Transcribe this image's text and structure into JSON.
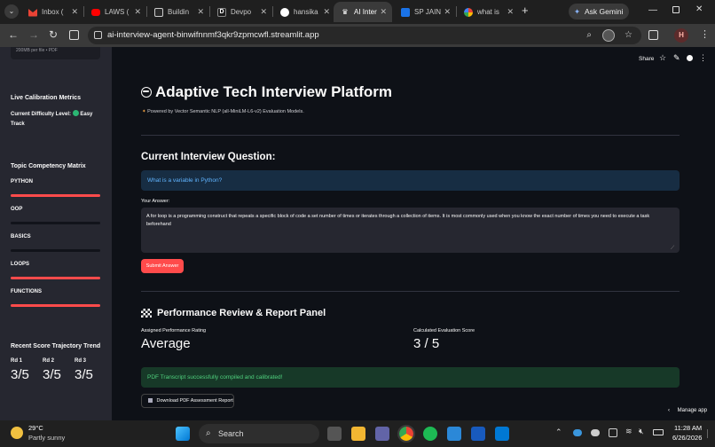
{
  "browser": {
    "tabs": [
      {
        "label": "Inbox (",
        "color": "#ea4335"
      },
      {
        "label": "LAWS (",
        "color": "#ff0000"
      },
      {
        "label": "Buildin",
        "color": "#5f6368"
      },
      {
        "label": "Devpo",
        "color": "#1a73e8"
      },
      {
        "label": "hansika",
        "color": "#ffffff"
      },
      {
        "label": "AI Inter",
        "color": "#ffffff"
      },
      {
        "label": "SP JAIN",
        "color": "#1a73e8"
      },
      {
        "label": "what is",
        "color": "#4285f4"
      }
    ],
    "ask_gemini": "Ask Gemini",
    "url": "ai-interview-agent-binwifnnmf3qkr9zpmcwfl.streamlit.app",
    "profile_initial": "H"
  },
  "toolbar": {
    "share": "Share"
  },
  "sidebar": {
    "upload_hint": "200MB per file • PDF",
    "metrics_title": "Live Calibration Metrics",
    "difficulty_label": "Current Difficulty Level:",
    "difficulty_value": "Easy",
    "difficulty_value2": "Track",
    "competency_title": "Topic Competency Matrix",
    "topics": [
      {
        "label": "PYTHON",
        "level": 1
      },
      {
        "label": "OOP",
        "level": 0
      },
      {
        "label": "BASICS",
        "level": 0
      },
      {
        "label": "LOOPS",
        "level": 1
      },
      {
        "label": "FUNCTIONS",
        "level": 1
      }
    ],
    "trend_title": "Recent Score Trajectory Trend",
    "rounds": [
      {
        "label": "Rd 1",
        "value": "3/5"
      },
      {
        "label": "Rd 2",
        "value": "3/5"
      },
      {
        "label": "Rd 3",
        "value": "3/5"
      }
    ]
  },
  "main": {
    "title": "Adaptive Tech Interview Platform",
    "powered": "Powered by Vector Semantic NLP (all-MiniLM-L6-v2) Evaluation Models.",
    "question_heading": "Current Interview Question:",
    "question": "What is a variable in Python?",
    "answer_label": "Your Answer:",
    "answer": "A for loop is a programming construct that repeats a specific block of code a set number of times or iterates through a collection of items. It is most commonly used when you know the exact number of times you need to execute a task beforehand",
    "submit": "Submit Answer",
    "review_heading": "Performance Review & Report Panel",
    "rating_label": "Assigned Performance Rating",
    "rating_value": "Average",
    "score_label": "Calculated Evaluation Score",
    "score_value": "3 / 5",
    "success": "PDF Transcript successfully compiled and calibrated!",
    "download": "Download PDF Assessment Report",
    "manage": "Manage app"
  },
  "taskbar": {
    "temp": "29°C",
    "weather": "Partly sunny",
    "search": "Search",
    "time": "11:28 AM",
    "date": "6/26/2026"
  },
  "colors": {
    "accent": "#ff4b4b",
    "info_bg": "#172d43",
    "info_text": "#60b4ff",
    "success_bg": "#173928",
    "success_text": "#4fd07d"
  }
}
